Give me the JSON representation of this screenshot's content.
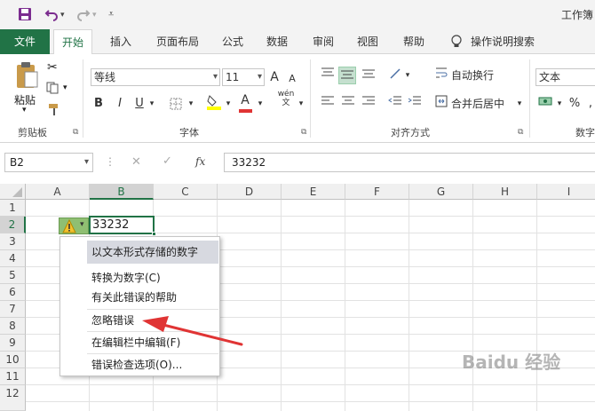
{
  "window": {
    "title": "工作簿"
  },
  "tabs": [
    "文件",
    "开始",
    "插入",
    "页面布局",
    "公式",
    "数据",
    "审阅",
    "视图",
    "帮助"
  ],
  "tell_me": "操作说明搜索",
  "ribbon": {
    "paste_label": "粘贴",
    "font_name": "等线",
    "font_size": "11",
    "bold": "B",
    "italic": "I",
    "underline": "U",
    "wrap_text": "自动换行",
    "merge_center": "合并后居中",
    "number_format": "文本",
    "percent": "%",
    "group_clipboard": "剪贴板",
    "group_font": "字体",
    "group_alignment": "对齐方式",
    "group_number": "数字",
    "font_grow": "A",
    "font_shrink": "A",
    "font_color": "A",
    "wen": "wén"
  },
  "formula_bar": {
    "name_box": "B2",
    "fx": "fx",
    "value": "33232",
    "cancel": "✕",
    "enter": "✓",
    "dots": "⋮"
  },
  "grid": {
    "columns": [
      "A",
      "B",
      "C",
      "D",
      "E",
      "F",
      "G",
      "H",
      "I"
    ],
    "rows": [
      "1",
      "2",
      "3",
      "4",
      "5",
      "6",
      "7",
      "8",
      "9",
      "10",
      "11",
      "12"
    ],
    "cell_b2": "33232"
  },
  "context_menu": {
    "header": "以文本形式存储的数字",
    "items": [
      "转换为数字(C)",
      "有关此错误的帮助",
      "忽略错误",
      "在编辑栏中编辑(F)",
      "错误检查选项(O)..."
    ]
  },
  "watermark": "Baidu 经验",
  "colors": {
    "excel_green": "#217346",
    "arrow_red": "#e03434",
    "menu_header_bg": "#d7d9e0",
    "warning_yellow": "#f2c12e"
  }
}
